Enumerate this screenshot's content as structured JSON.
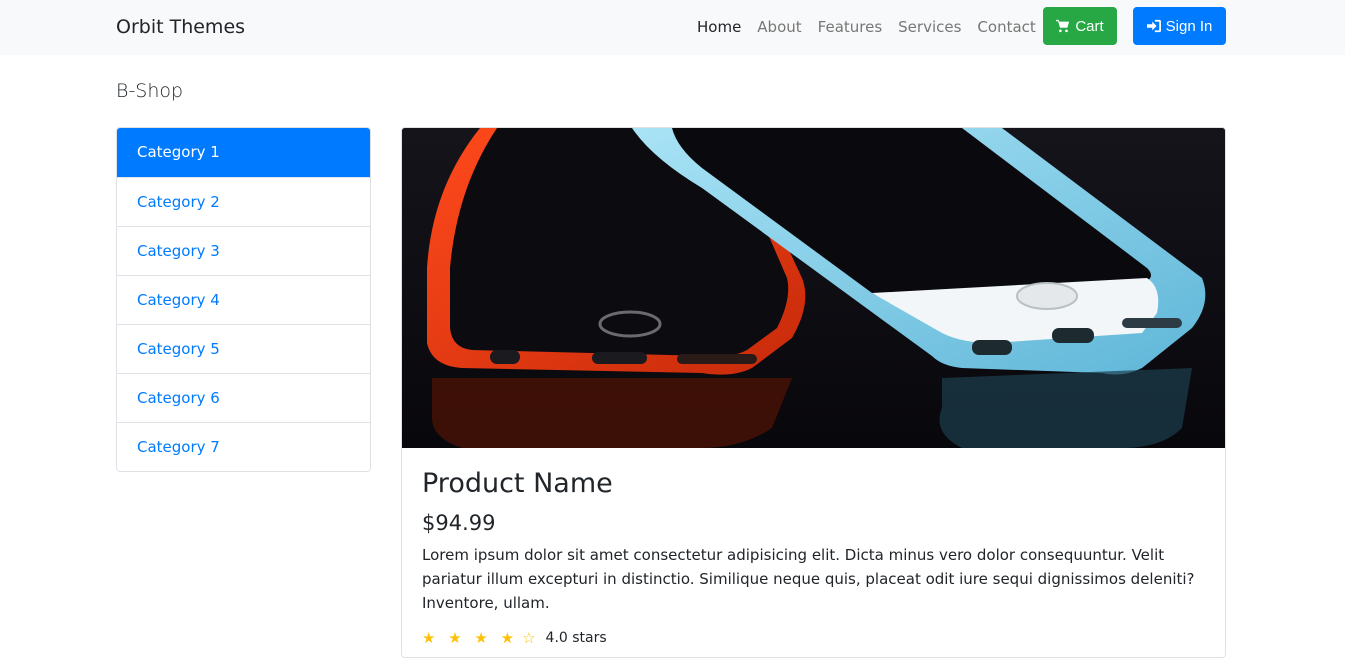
{
  "navbar": {
    "brand": "Orbit Themes",
    "links": [
      "Home",
      "About",
      "Features",
      "Services",
      "Contact"
    ],
    "cart_label": "Cart",
    "signin_label": "Sign In"
  },
  "shop_title": "B-Shop",
  "categories": [
    "Category 1",
    "Category 2",
    "Category 3",
    "Category 4",
    "Category 5",
    "Category 6",
    "Category 7"
  ],
  "product": {
    "name": "Product Name",
    "price": "$94.99",
    "description": "Lorem ipsum dolor sit amet consectetur adipisicing elit. Dicta minus vero dolor consequuntur. Velit pariatur illum excepturi in distinctio. Similique neque quis, placeat odit iure sequi dignissimos deleniti? Inventore, ullam.",
    "stars_filled": "★ ★ ★ ★",
    "stars_empty": "☆",
    "rating_text": "4.0 stars",
    "rating_value": 4.0
  },
  "colors": {
    "primary": "#007bff",
    "success": "#28a745",
    "star": "#ffc107",
    "navbar_bg": "#f8f9fa"
  }
}
